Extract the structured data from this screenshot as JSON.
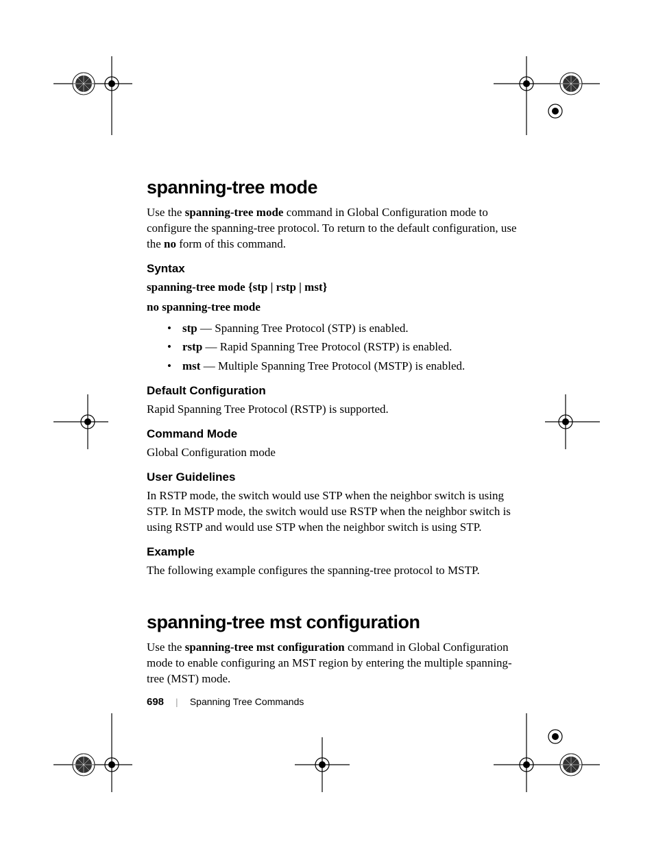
{
  "section1": {
    "title": "spanning-tree mode",
    "intro_pre": "Use the ",
    "intro_cmd": "spanning-tree mode",
    "intro_mid": " command in Global Configuration mode to configure the spanning-tree protocol. To return to the default configuration, use the ",
    "intro_no": "no",
    "intro_post": " form of this command.",
    "syntax_heading": "Syntax",
    "syntax_cmd": "spanning-tree mode",
    "syntax_args": " {stp | rstp | mst}",
    "syntax_no": "no spanning-tree mode",
    "bullets": [
      {
        "term": "stp",
        "desc": " — Spanning Tree Protocol (STP) is enabled."
      },
      {
        "term": "rstp",
        "desc": " — Rapid Spanning Tree Protocol (RSTP) is enabled."
      },
      {
        "term": "mst",
        "desc": " — Multiple Spanning Tree Protocol (MSTP) is enabled."
      }
    ],
    "default_heading": "Default Configuration",
    "default_text": "Rapid Spanning Tree Protocol (RSTP) is supported.",
    "mode_heading": "Command Mode",
    "mode_text": "Global Configuration mode",
    "guidelines_heading": "User Guidelines",
    "guidelines_text": "In RSTP mode, the switch would use STP when the neighbor switch is using STP. In MSTP mode, the switch would use RSTP when the neighbor switch is using RSTP and would use STP when the neighbor switch is using STP.",
    "example_heading": "Example",
    "example_text": "The following example configures the spanning-tree protocol to MSTP."
  },
  "section2": {
    "title": "spanning-tree mst configuration",
    "intro_pre": "Use the ",
    "intro_cmd": "spanning-tree mst configuration",
    "intro_post": " command in Global Configuration mode to enable configuring an MST region by entering the multiple spanning-tree (MST) mode."
  },
  "footer": {
    "page": "698",
    "section": "Spanning Tree Commands"
  }
}
